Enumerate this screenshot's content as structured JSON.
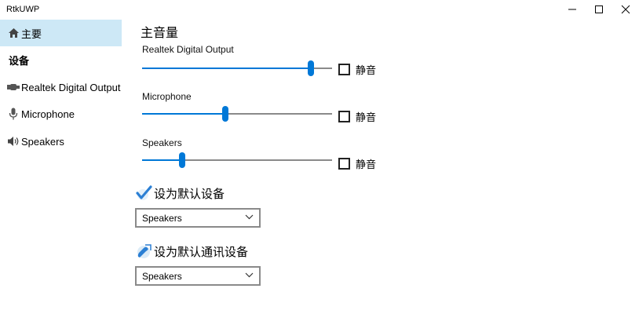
{
  "window": {
    "title": "RtkUWP"
  },
  "sidebar": {
    "items": [
      {
        "label": "主要",
        "icon": "home-icon",
        "selected": true
      },
      {
        "label": "设备",
        "header": true
      },
      {
        "label": "Realtek Digital Output",
        "icon": "digital-output-icon"
      },
      {
        "label": "Microphone",
        "icon": "microphone-icon"
      },
      {
        "label": "Speakers",
        "icon": "speaker-icon"
      }
    ]
  },
  "main": {
    "title": "主音量",
    "mute_label": "静音",
    "devices": [
      {
        "name": "Realtek Digital Output",
        "volume_fraction": 0.89,
        "muted": false
      },
      {
        "name": "Microphone",
        "volume_fraction": 0.44,
        "muted": false
      },
      {
        "name": "Speakers",
        "volume_fraction": 0.21,
        "muted": false
      }
    ],
    "default_device": {
      "title": "设为默认设备",
      "icon": "checkmark-icon",
      "selected": "Speakers"
    },
    "default_comm_device": {
      "title": "设为默认通讯设备",
      "icon": "phone-icon",
      "selected": "Speakers"
    }
  },
  "colors": {
    "accent": "#0078d7",
    "selected_nav": "#cde8f6",
    "track": "#8a8a8a"
  }
}
